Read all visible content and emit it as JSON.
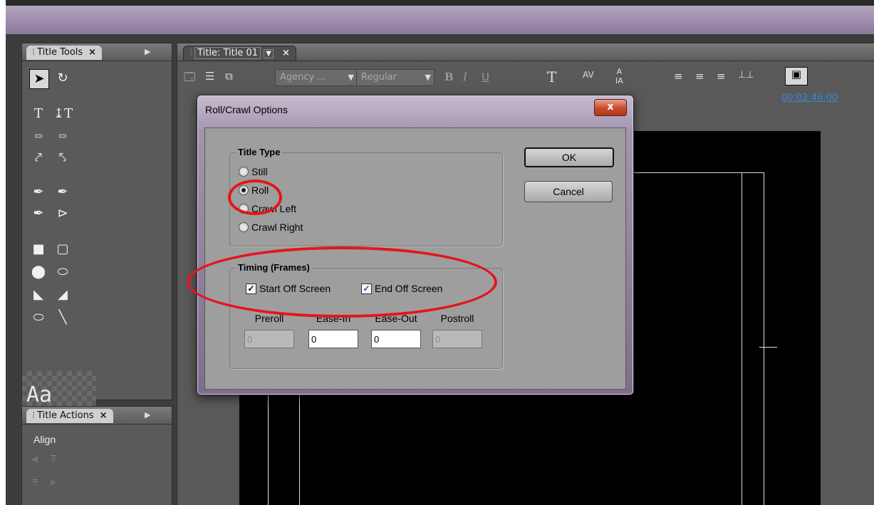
{
  "title_tools_panel": {
    "tab_label": "Title Tools",
    "close_label": "×",
    "aa_preview": "Aa"
  },
  "title_actions_panel": {
    "tab_label": "Title Actions",
    "close_label": "×",
    "align_label": "Align"
  },
  "title_panel": {
    "tab_label": "Title: Title 01",
    "dropdown_glyph": "▼",
    "close_label": "×",
    "font_family": "Agency ...",
    "font_style": "Regular",
    "timecode": "00:02:46:00"
  },
  "dialog": {
    "title": "Roll/Crawl Options",
    "close_glyph": "x",
    "title_type": {
      "label": "Title Type",
      "options": [
        "Still",
        "Roll",
        "Crawl Left",
        "Crawl Right"
      ],
      "selected": "Roll"
    },
    "timing": {
      "label": "Timing (Frames)",
      "start_off_screen": {
        "label": "Start Off Screen",
        "checked": true
      },
      "end_off_screen": {
        "label": "End Off Screen",
        "checked": true
      },
      "fields": [
        {
          "label": "Preroll",
          "value": "0",
          "enabled": false
        },
        {
          "label": "Ease-In",
          "value": "0",
          "enabled": true
        },
        {
          "label": "Ease-Out",
          "value": "0",
          "enabled": true
        },
        {
          "label": "Postroll",
          "value": "0",
          "enabled": false
        }
      ]
    },
    "ok_label": "OK",
    "cancel_label": "Cancel"
  },
  "colors": {
    "annotation": "#e3161b",
    "timecode": "#3a86d6",
    "dialog_frame": "#a394b0"
  }
}
